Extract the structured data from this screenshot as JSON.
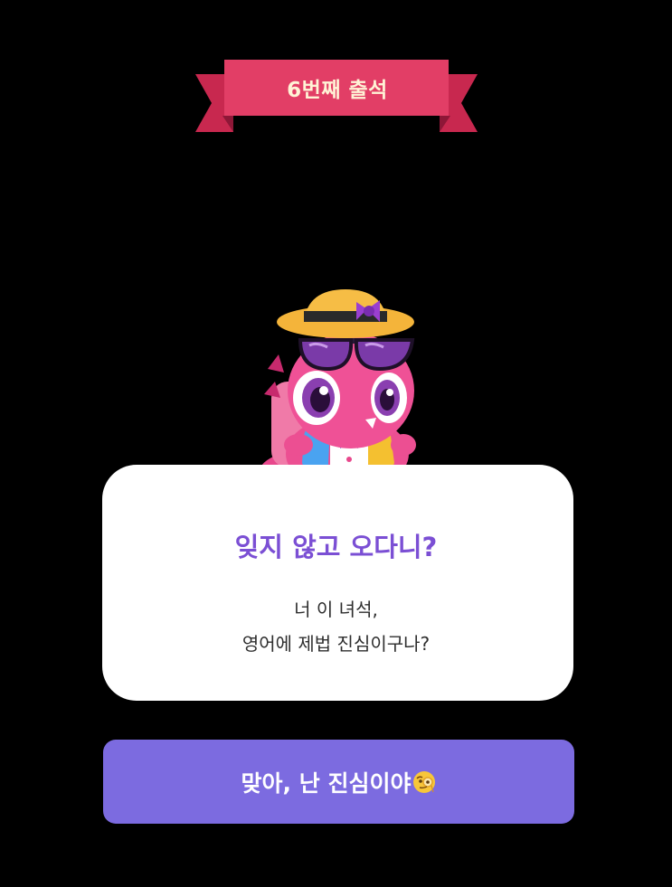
{
  "banner": {
    "text": "6번째 출석"
  },
  "mascot": {
    "icon": "pink-dinosaur-mascot-icon"
  },
  "dialog": {
    "title": "잊지 않고 오다니?",
    "body_lines": [
      "너 이 녀석,",
      "영어에 제법 진심이구나?"
    ]
  },
  "cta": {
    "label": "맞아, 난 진심이야",
    "emoji_icon": "monocle-face-emoji-icon"
  },
  "colors": {
    "background": "#000000",
    "ribbon": "#e23e66",
    "ribbon_dark": "#b1204a",
    "title": "#7b4fd4",
    "button": "#7c6be0"
  }
}
